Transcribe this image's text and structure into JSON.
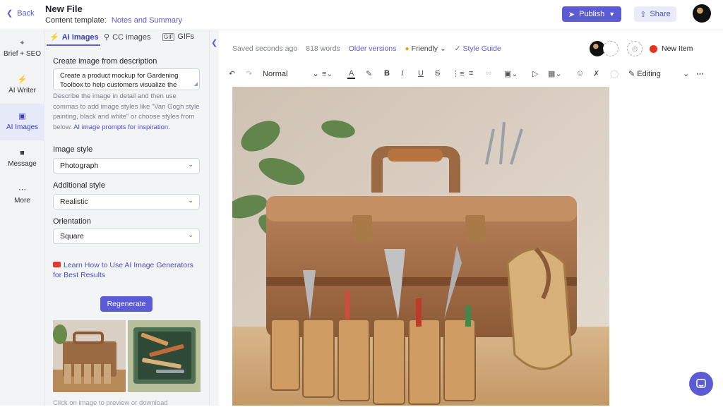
{
  "topbar": {
    "back_label": "Back",
    "file_title": "New File",
    "template_label": "Content template:",
    "template_value": "Notes and Summary",
    "publish_label": "Publish",
    "share_label": "Share"
  },
  "rail": {
    "items": [
      {
        "label": "Brief + SEO",
        "icon": "crosshair-icon"
      },
      {
        "label": "AI Writer",
        "icon": "bolt-icon"
      },
      {
        "label": "AI Images",
        "icon": "image-icon"
      },
      {
        "label": "Message",
        "icon": "message-icon"
      },
      {
        "label": "More",
        "icon": "more-icon"
      }
    ]
  },
  "panel": {
    "tabs": [
      {
        "label": "AI images"
      },
      {
        "label": "CC images"
      },
      {
        "label": "GIFs"
      }
    ],
    "create_label": "Create image from description",
    "description_value": "Create a product mockup for Gardening Toolbox to help customers visualize the",
    "help_text": "Describe the image in detail and then use commas to add image styles like \"Van Gogh style painting, black and white\" or choose styles from below.",
    "help_link": "AI image prompts for inspiration.",
    "image_style_label": "Image style",
    "image_style_value": "Photograph",
    "additional_style_label": "Additional style",
    "additional_style_value": "Realistic",
    "orientation_label": "Orientation",
    "orientation_value": "Square",
    "learn_link": "Learn How to Use AI Image Generators for Best Results",
    "regenerate_label": "Regenerate",
    "footnote": "Click on image to preview or download"
  },
  "editor": {
    "saved_status": "Saved seconds ago",
    "word_count": "818 words",
    "older_versions": "Older versions",
    "tone_label": "Friendly",
    "style_guide": "Style Guide",
    "new_item": "New Item",
    "paragraph_style": "Normal",
    "mode_label": "Editing"
  },
  "colors": {
    "accent": "#5b5bd6",
    "status_red": "#e8321f"
  }
}
